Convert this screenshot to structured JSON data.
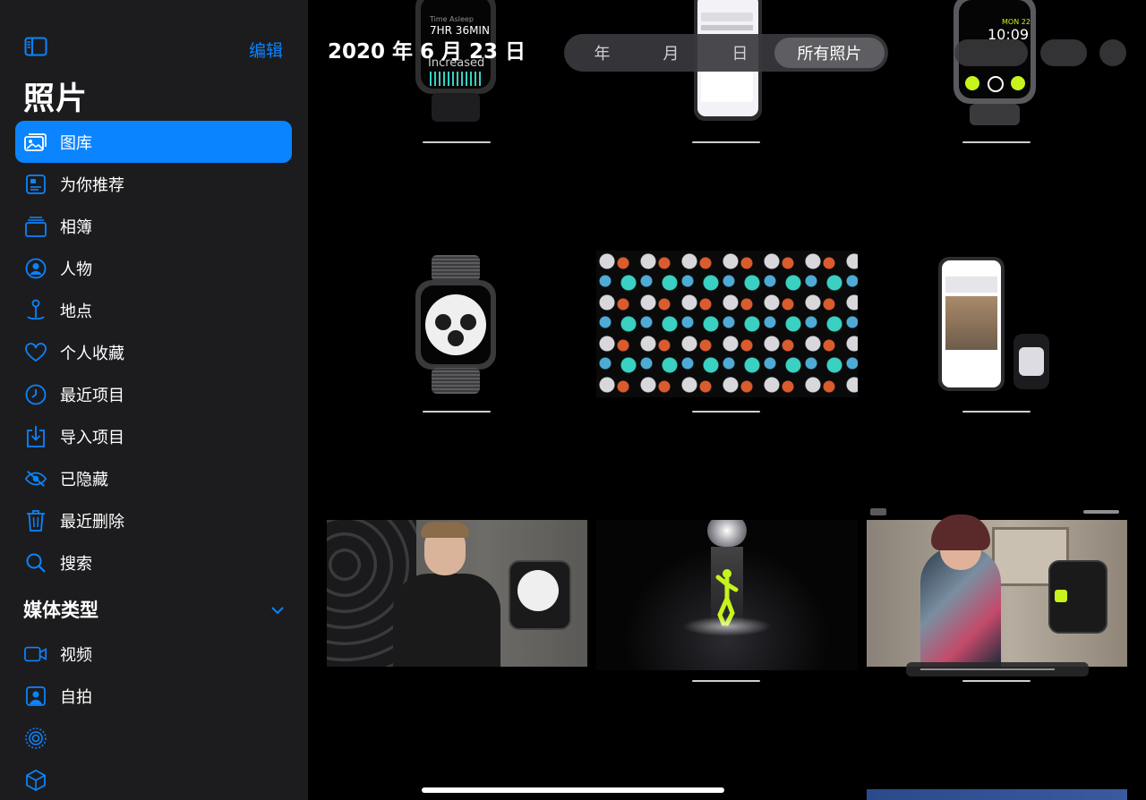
{
  "sidebar": {
    "edit_label": "编辑",
    "title": "照片",
    "items": [
      {
        "label": "图库",
        "icon": "photo-library-icon",
        "active": true
      },
      {
        "label": "为你推荐",
        "icon": "for-you-icon"
      },
      {
        "label": "相簿",
        "icon": "albums-icon"
      },
      {
        "label": "人物",
        "icon": "people-icon"
      },
      {
        "label": "地点",
        "icon": "places-icon"
      },
      {
        "label": "个人收藏",
        "icon": "heart-icon"
      },
      {
        "label": "最近项目",
        "icon": "clock-icon"
      },
      {
        "label": "导入项目",
        "icon": "import-icon"
      },
      {
        "label": "已隐藏",
        "icon": "eye-slash-icon"
      },
      {
        "label": "最近删除",
        "icon": "trash-icon"
      },
      {
        "label": "搜索",
        "icon": "search-icon"
      }
    ],
    "media_section": {
      "title": "媒体类型",
      "items": [
        {
          "label": "视频",
          "icon": "video-icon"
        },
        {
          "label": "自拍",
          "icon": "selfie-icon"
        },
        {
          "label": "",
          "icon": "live-photos-icon"
        },
        {
          "label": "",
          "icon": "cube-icon"
        }
      ]
    }
  },
  "main": {
    "date_title": "2020 年 6 月 23 日",
    "segments": [
      "年",
      "月",
      "日",
      "所有照片"
    ],
    "selected_segment": "所有照片"
  },
  "photos": {
    "watch1": {
      "line1": "Time Asleep",
      "line2": "7HR 36MIN",
      "line3": "Increased"
    },
    "watch3": {
      "day": "MON 22",
      "time": "10:09"
    },
    "tiles": [
      {
        "name": "sleep-watch-photo"
      },
      {
        "name": "iphone-schedule-photo"
      },
      {
        "name": "nike-watch-photo"
      },
      {
        "name": "chronograph-watch-photo"
      },
      {
        "name": "watch-faces-grid-photo"
      },
      {
        "name": "iphone-watch-app-photo"
      },
      {
        "name": "presenter-video-photo"
      },
      {
        "name": "dance-workout-photo"
      },
      {
        "name": "functional-training-video-photo"
      }
    ]
  },
  "colors": {
    "accent": "#0a84ff",
    "sidebar_bg": "#1c1c1e",
    "main_bg": "#000000"
  }
}
